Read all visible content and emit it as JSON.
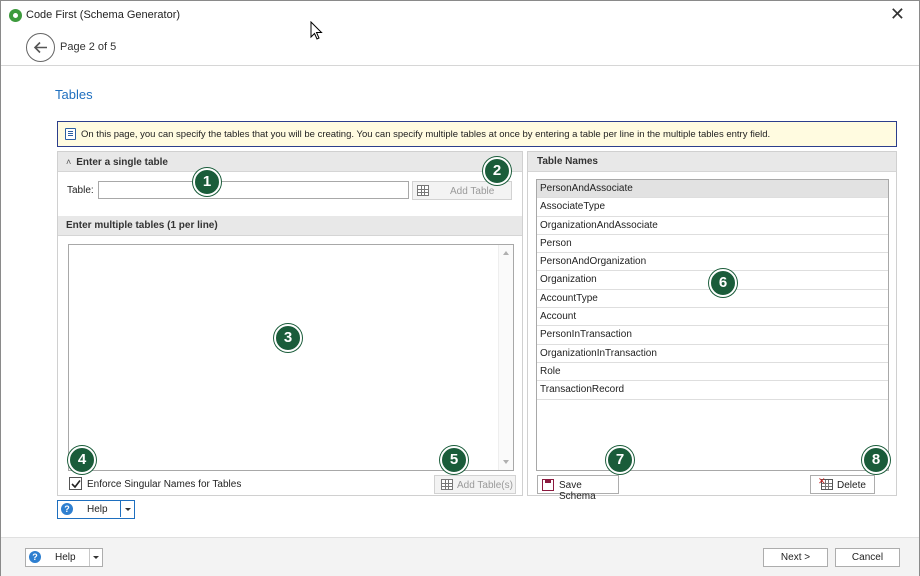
{
  "window": {
    "title": "Code First (Schema Generator)"
  },
  "nav": {
    "page_counter": "Page 2 of 5"
  },
  "page": {
    "title": "Tables",
    "info_text": "On this page, you can specify the tables that you will be creating. You can specify multiple tables at once by entering a table per line in the multiple tables entry field."
  },
  "single_table": {
    "header": "Enter a single table",
    "label": "Table:",
    "value": "",
    "add_button": "Add Table"
  },
  "multi_table": {
    "header": "Enter multiple tables (1 per line)",
    "value": "",
    "enforce_label": "Enforce Singular Names for Tables",
    "enforce_checked": true,
    "add_button": "Add Table(s)"
  },
  "table_names": {
    "header": "Table Names",
    "items": [
      "PersonAndAssociate",
      "AssociateType",
      "OrganizationAndAssociate",
      "Person",
      "PersonAndOrganization",
      "Organization",
      "AccountType",
      "Account",
      "PersonInTransaction",
      "OrganizationInTransaction",
      "Role",
      "TransactionRecord"
    ],
    "selected_index": 0,
    "save_button": "Save Schema",
    "delete_button": "Delete"
  },
  "help_split": {
    "label": "Help",
    "icon": "?"
  },
  "footer": {
    "help_label": "Help",
    "help_icon": "?",
    "next_label": "Next >",
    "cancel_label": "Cancel"
  },
  "callouts": [
    "1",
    "2",
    "3",
    "4",
    "5",
    "6",
    "7",
    "8"
  ],
  "colors": {
    "accent": "#1e6fbf",
    "callout": "#1a5c3a",
    "banner_bg": "#fffbe0",
    "banner_border": "#2c3e8c"
  }
}
